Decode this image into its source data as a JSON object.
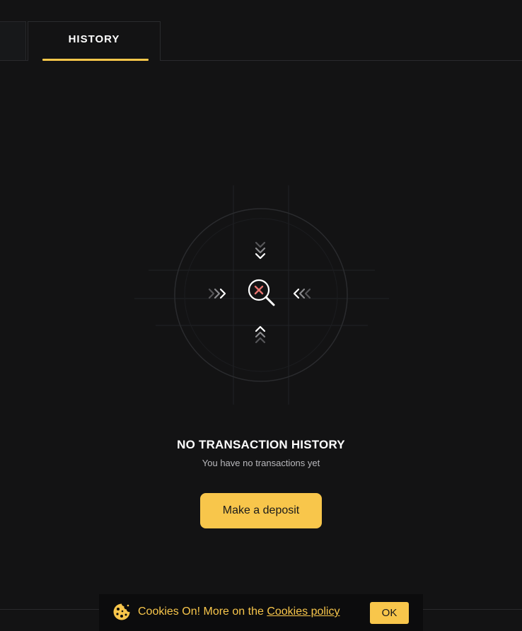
{
  "tabs": {
    "active_label": "HISTORY"
  },
  "empty_state": {
    "title": "NO TRANSACTION HISTORY",
    "subtitle": "You have no transactions yet",
    "deposit_button": "Make a deposit"
  },
  "cookie_banner": {
    "text": "Cookies On! More on the ",
    "link_label": "Cookies policy",
    "ok_label": "OK"
  },
  "colors": {
    "background": "#131314",
    "accent": "#f8c64b",
    "banner_background": "#0c0c0d"
  },
  "icons": {
    "illustration": "search-no-results-icon",
    "cookie": "cookie-icon"
  }
}
